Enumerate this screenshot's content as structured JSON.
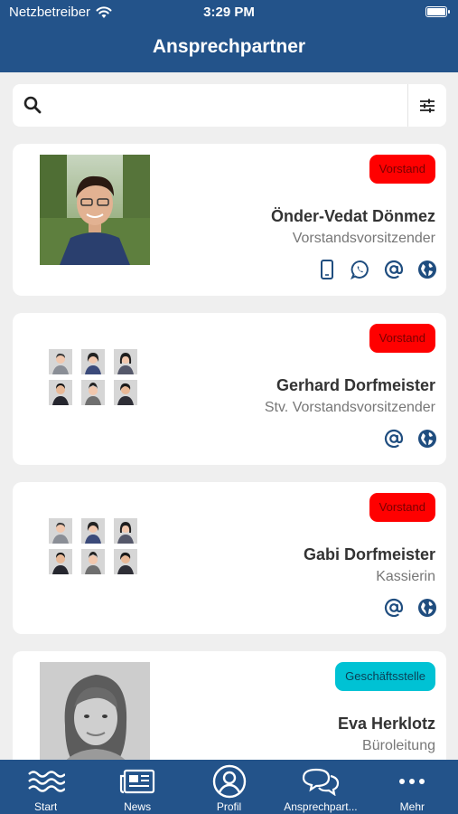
{
  "status_bar": {
    "carrier": "Netzbetreiber",
    "time": "3:29 PM",
    "battery_level": 1.0
  },
  "header": {
    "title": "Ansprechpartner"
  },
  "search": {
    "placeholder": "",
    "value": ""
  },
  "contacts": [
    {
      "badge": "Vorstand",
      "badge_color": "#ff0000",
      "name": "Önder-Vedat Dönmez",
      "role": "Vorstandsvorsitzender",
      "photo": "photo",
      "actions": [
        "mobile-icon",
        "whatsapp-icon",
        "email-icon",
        "web-icon"
      ]
    },
    {
      "badge": "Vorstand",
      "badge_color": "#ff0000",
      "name": "Gerhard Dorfmeister",
      "role": "Stv. Vorstandsvorsitzender",
      "photo": "placeholder-avatars",
      "actions": [
        "email-icon",
        "web-icon"
      ]
    },
    {
      "badge": "Vorstand",
      "badge_color": "#ff0000",
      "name": "Gabi Dorfmeister",
      "role": "Kassierin",
      "photo": "placeholder-avatars",
      "actions": [
        "email-icon",
        "web-icon"
      ]
    },
    {
      "badge": "Geschäftsstelle",
      "badge_color": "#00c2d4",
      "name": "Eva Herklotz",
      "role": "Büroleitung",
      "photo": "photo-grayscale",
      "actions": []
    }
  ],
  "tab_bar": {
    "items": [
      {
        "label": "Start",
        "icon": "waves-icon"
      },
      {
        "label": "News",
        "icon": "newspaper-icon"
      },
      {
        "label": "Profil",
        "icon": "profile-icon"
      },
      {
        "label": "Ansprechpart...",
        "icon": "chat-bubbles-icon"
      },
      {
        "label": "Mehr",
        "icon": "more-dots-icon"
      }
    ]
  },
  "colors": {
    "primary": "#23538a",
    "background": "#efefef",
    "icon_blue": "#1f4d7f",
    "badge_red": "#ff0000",
    "badge_cyan": "#00c2d4"
  }
}
